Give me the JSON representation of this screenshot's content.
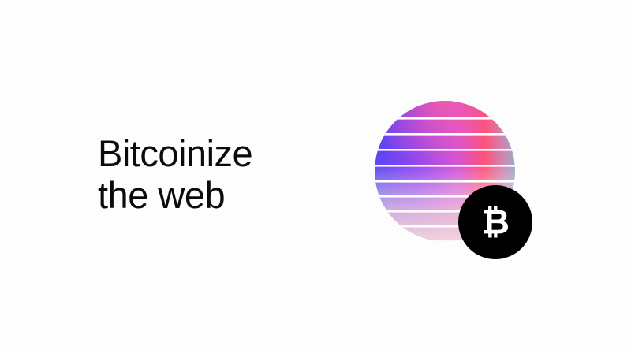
{
  "headline": {
    "line1": "Bitcoinize",
    "line2": "the web"
  },
  "badge": {
    "glyph": "₿",
    "background": "#000000",
    "foreground": "#ffffff"
  },
  "colors": {
    "gradient_violet": "#5b3cf0",
    "gradient_magenta": "#c23ef0",
    "gradient_pink": "#ff4a78",
    "gradient_teal": "#3ed6c8",
    "gradient_blush": "#f6d6d2",
    "text": "#0b0b0b",
    "background": "#fdfdfd"
  },
  "icons": {
    "sphere": "striped-gradient-sphere-icon",
    "bitcoin": "bitcoin-icon"
  }
}
